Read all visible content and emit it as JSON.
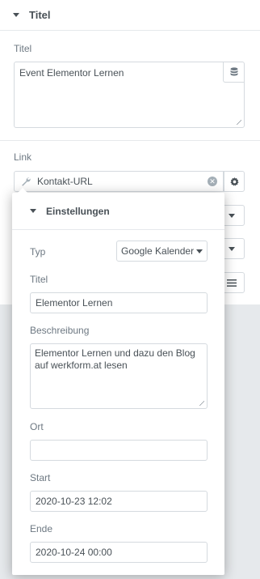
{
  "section": {
    "title": "Titel"
  },
  "title_control": {
    "label": "Titel",
    "value": "Event Elementor Lernen"
  },
  "link_control": {
    "label": "Link",
    "value": "Kontakt-URL"
  },
  "popover": {
    "title": "Einstellungen",
    "typ": {
      "label": "Typ",
      "selected": "Google Kalender"
    },
    "titel": {
      "label": "Titel",
      "value": "Elementor Lernen"
    },
    "beschreibung": {
      "label": "Beschreibung",
      "value": "Elementor Lernen und dazu den Blog auf werkform.at lesen"
    },
    "ort": {
      "label": "Ort",
      "value": ""
    },
    "start": {
      "label": "Start",
      "value": "2020-10-23 12:02"
    },
    "ende": {
      "label": "Ende",
      "value": "2020-10-24 00:00"
    }
  },
  "colors": {
    "panel_bg": "#e6e9ec",
    "border": "#d5dadf",
    "text": "#495157",
    "label": "#6d7882"
  },
  "icons": [
    "caret-down-icon",
    "database-icon",
    "wrench-icon",
    "clear-icon",
    "gear-icon",
    "align-icon"
  ]
}
